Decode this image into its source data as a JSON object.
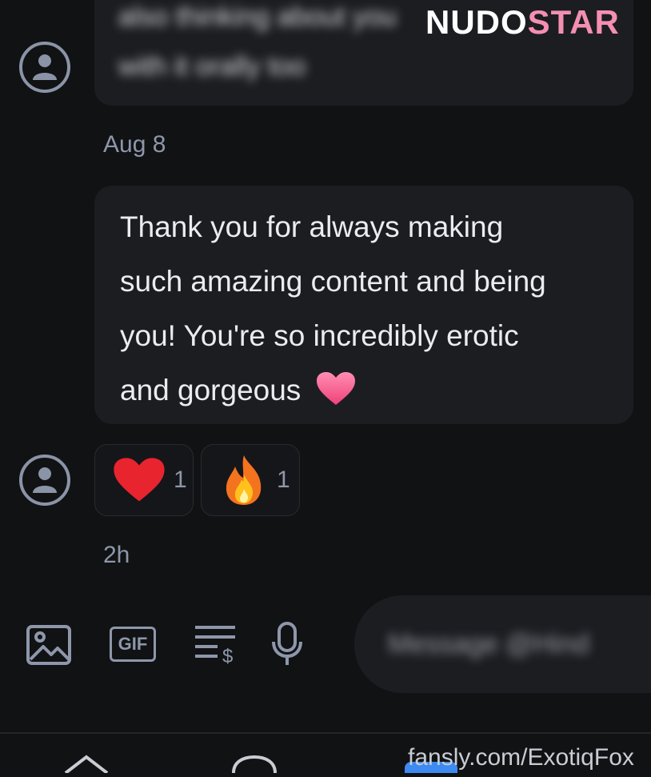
{
  "thread": {
    "prev_message_blurred": [
      "also thinking about you",
      "with it orally too"
    ],
    "date_label": "Aug 8",
    "message_lines": [
      "Thank you for always making",
      "such amazing content and being",
      "you! You're so incredibly erotic",
      "and gorgeous"
    ],
    "message_emoji": "❤",
    "reactions": [
      {
        "emoji": "❤",
        "count": "1",
        "icon": "heart-icon"
      },
      {
        "emoji": "🔥",
        "count": "1",
        "icon": "fire-icon"
      }
    ],
    "time_label": "2h"
  },
  "composer": {
    "placeholder_blurred": "Message @Hind",
    "tools": {
      "image": "image-icon",
      "gif_label": "GIF",
      "tip": "tip-list-icon",
      "mic": "microphone-icon"
    }
  },
  "watermark": {
    "brand_part1": "NUDO",
    "brand_part2": "STAR",
    "url": "fansly.com/ExotiqFox"
  },
  "colors": {
    "background": "#111214",
    "bubble": "#1c1d21",
    "muted": "#8e97aa",
    "brand_pink": "#f48fb1"
  }
}
